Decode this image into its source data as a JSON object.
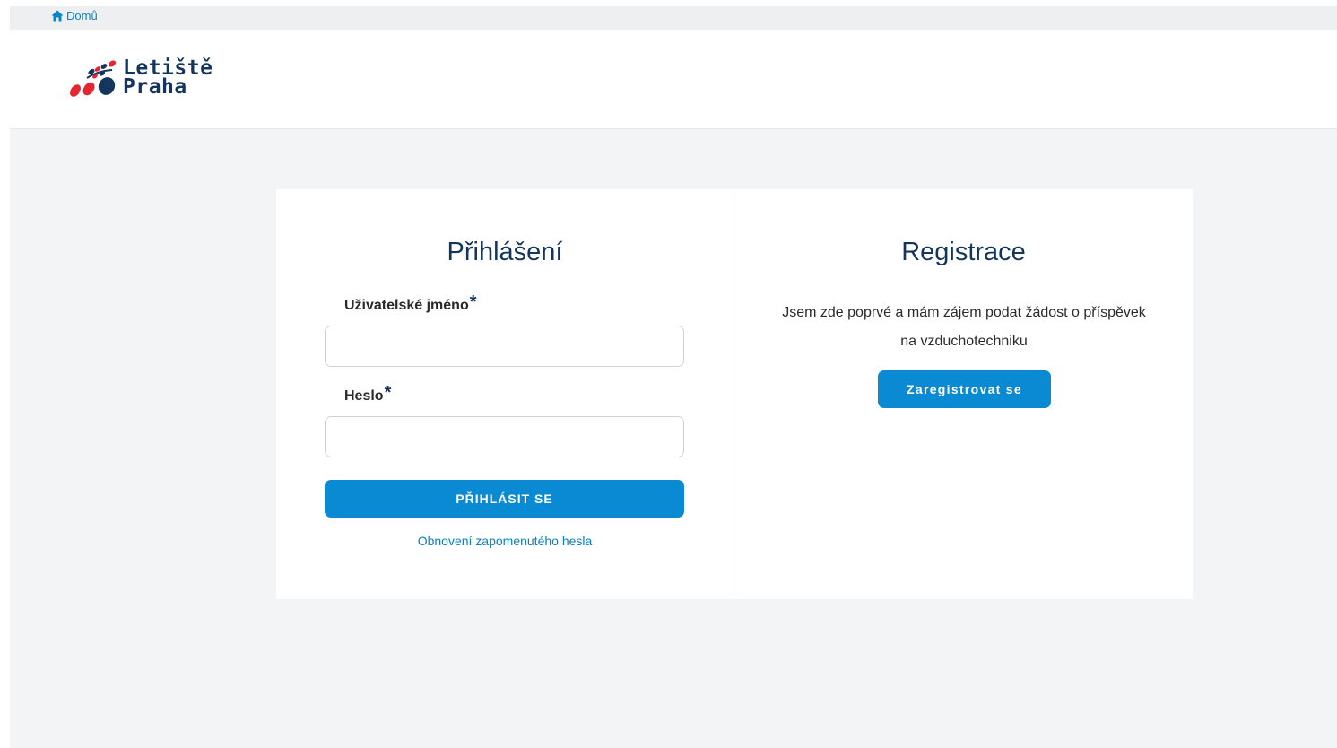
{
  "nav": {
    "home_label": "Domů",
    "home_icon": "home-icon"
  },
  "brand": {
    "logo_line1": "Letiště",
    "logo_line2": "Praha",
    "colors": {
      "navy": "#14365e",
      "red": "#e3262f"
    }
  },
  "login": {
    "title": "Přihlášení",
    "username_label": "Uživatelské jméno",
    "username_required": "*",
    "username_value": "",
    "password_label": "Heslo",
    "password_required": "*",
    "password_value": "",
    "submit_label": "PŘIHLÁSIT SE",
    "forgot_link": "Obnovení zapomenutého hesla"
  },
  "registration": {
    "title": "Registrace",
    "description": "Jsem zde poprvé a mám zájem podat žádost o příspěvek na vzduchotechniku",
    "button_label": "Zaregistrovat se"
  },
  "theme": {
    "accent": "#0a8ad2",
    "background": "#f3f4f5",
    "title_color": "#14365e"
  }
}
